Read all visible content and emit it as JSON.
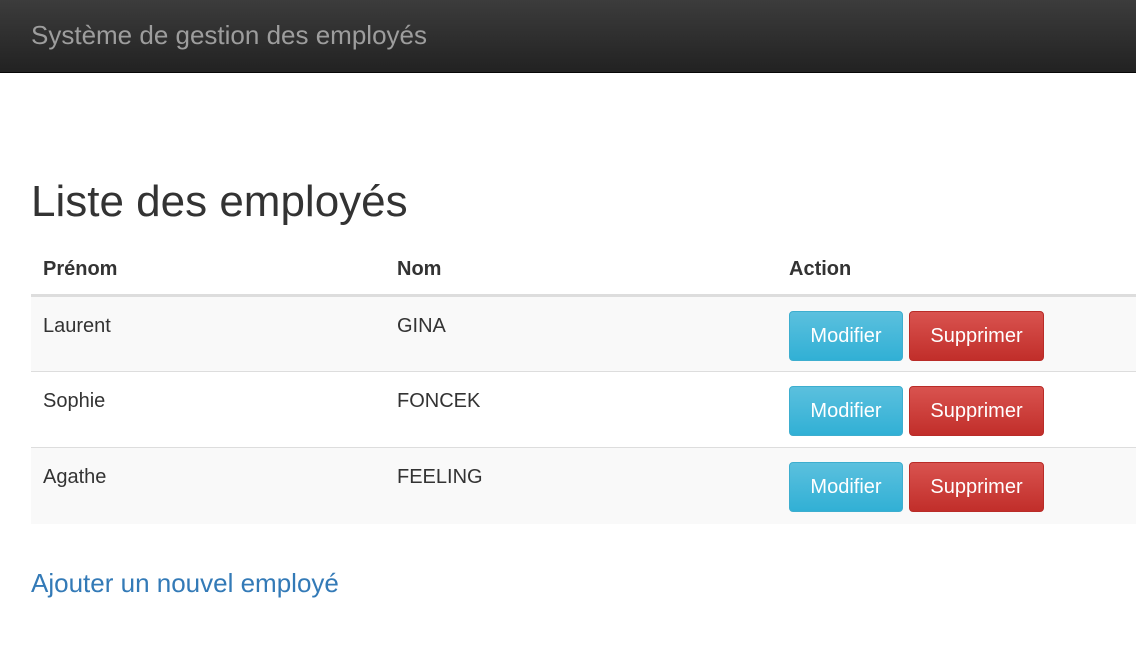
{
  "navbar": {
    "brand": "Système de gestion des employés"
  },
  "main": {
    "title": "Liste des employés",
    "table": {
      "headers": [
        "Prénom",
        "Nom",
        "Action"
      ],
      "rows": [
        {
          "first_name": "Laurent",
          "last_name": "GINA",
          "edit_label": "Modifier",
          "delete_label": "Supprimer"
        },
        {
          "first_name": "Sophie",
          "last_name": "FONCEK",
          "edit_label": "Modifier",
          "delete_label": "Supprimer"
        },
        {
          "first_name": "Agathe",
          "last_name": "FEELING",
          "edit_label": "Modifier",
          "delete_label": "Supprimer"
        }
      ]
    },
    "add_link": "Ajouter un nouvel employé"
  },
  "colors": {
    "navbar_bg": "#222222",
    "brand_text": "#9d9d9d",
    "info_button": "#5bc0de",
    "danger_button": "#d9534f",
    "link": "#337ab7"
  }
}
